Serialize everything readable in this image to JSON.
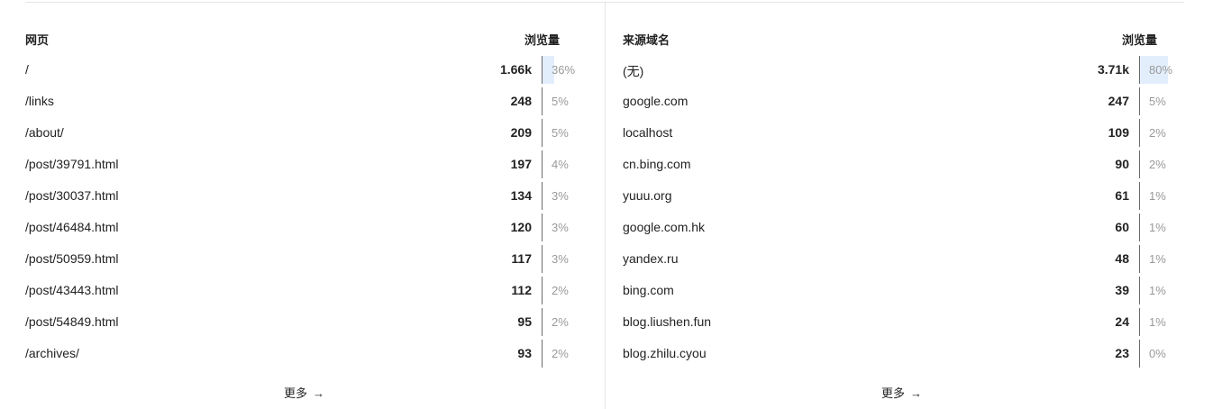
{
  "pages_panel": {
    "header_name": "网页",
    "header_views": "浏览量",
    "more_label": "更多",
    "more_icon": "arrow-right-icon",
    "rows": [
      {
        "name": "/",
        "count": "1.66k",
        "pct": "36%",
        "fraction": 0.36
      },
      {
        "name": "/links",
        "count": "248",
        "pct": "5%",
        "fraction": 0.05
      },
      {
        "name": "/about/",
        "count": "209",
        "pct": "5%",
        "fraction": 0.05
      },
      {
        "name": "/post/39791.html",
        "count": "197",
        "pct": "4%",
        "fraction": 0.04
      },
      {
        "name": "/post/30037.html",
        "count": "134",
        "pct": "3%",
        "fraction": 0.03
      },
      {
        "name": "/post/46484.html",
        "count": "120",
        "pct": "3%",
        "fraction": 0.03
      },
      {
        "name": "/post/50959.html",
        "count": "117",
        "pct": "3%",
        "fraction": 0.03
      },
      {
        "name": "/post/43443.html",
        "count": "112",
        "pct": "2%",
        "fraction": 0.02
      },
      {
        "name": "/post/54849.html",
        "count": "95",
        "pct": "2%",
        "fraction": 0.02
      },
      {
        "name": "/archives/",
        "count": "93",
        "pct": "2%",
        "fraction": 0.02
      }
    ]
  },
  "referrers_panel": {
    "header_name": "来源域名",
    "header_views": "浏览量",
    "more_label": "更多",
    "more_icon": "arrow-right-icon",
    "rows": [
      {
        "name": "(无)",
        "count": "3.71k",
        "pct": "80%",
        "fraction": 0.8
      },
      {
        "name": "google.com",
        "count": "247",
        "pct": "5%",
        "fraction": 0.05
      },
      {
        "name": "localhost",
        "count": "109",
        "pct": "2%",
        "fraction": 0.02
      },
      {
        "name": "cn.bing.com",
        "count": "90",
        "pct": "2%",
        "fraction": 0.02
      },
      {
        "name": "yuuu.org",
        "count": "61",
        "pct": "1%",
        "fraction": 0.01
      },
      {
        "name": "google.com.hk",
        "count": "60",
        "pct": "1%",
        "fraction": 0.01
      },
      {
        "name": "yandex.ru",
        "count": "48",
        "pct": "1%",
        "fraction": 0.01
      },
      {
        "name": "bing.com",
        "count": "39",
        "pct": "1%",
        "fraction": 0.01
      },
      {
        "name": "blog.liushen.fun",
        "count": "24",
        "pct": "1%",
        "fraction": 0.01
      },
      {
        "name": "blog.zhilu.cyou",
        "count": "23",
        "pct": "0%",
        "fraction": 0.0
      }
    ]
  },
  "colors": {
    "bar_fill": "#e3eefc",
    "bar_line": "#6b6b6b",
    "pct_text": "#999999",
    "divider": "#e6e6e6"
  }
}
